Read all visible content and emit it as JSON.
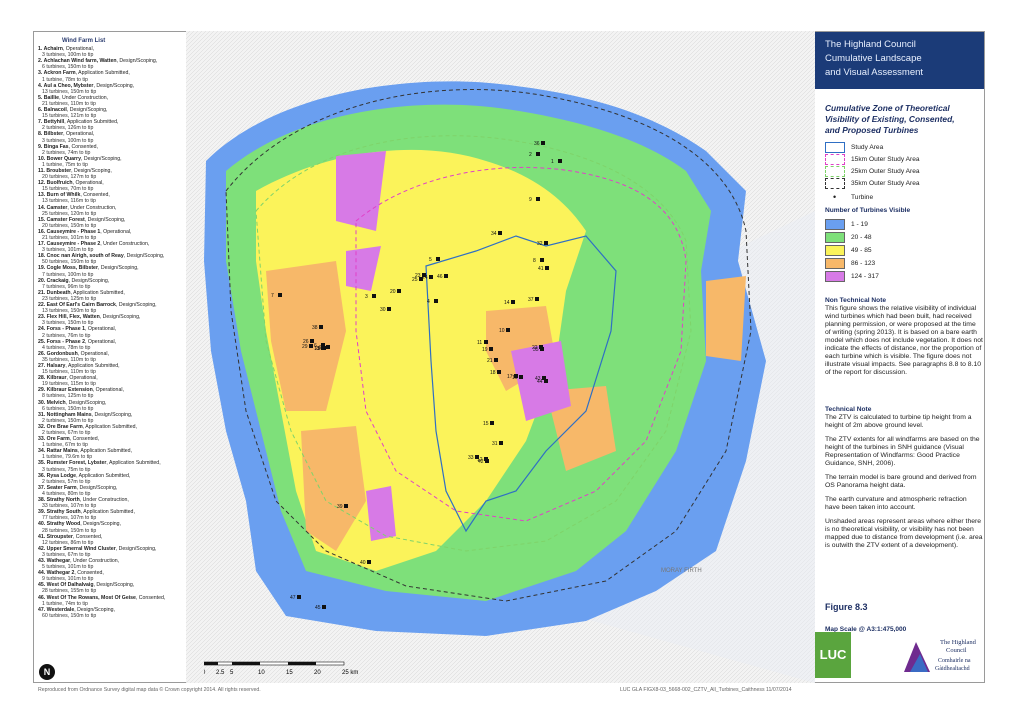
{
  "wind_farm_list": {
    "title": "Wind Farm List",
    "items": [
      {
        "name": "1. Achairn",
        "status": ", Operational,",
        "detail": "3 turbines, 100m to tip"
      },
      {
        "name": "2. Achlachan Wind farm, Watten",
        "status": ", Design/Scoping,",
        "detail": "6 turbines, 150m to tip"
      },
      {
        "name": "3. Ackron Farm",
        "status": ", Application Submitted,",
        "detail": "1 turbine, 78m to tip"
      },
      {
        "name": "4. Aul a Cheo, Mybster",
        "status": ", Design/Scoping,",
        "detail": "13 turbines, 150m to tip"
      },
      {
        "name": "5. Baillie",
        "status": ", Under Construction,",
        "detail": "21 turbines, 110m to tip"
      },
      {
        "name": "6. Balnacoil",
        "status": ", Design/Scoping,",
        "detail": "15 turbines, 121m to tip"
      },
      {
        "name": "7. Bettyhill",
        "status": ", Application Submitted,",
        "detail": "2 turbines, 126m to tip"
      },
      {
        "name": "8. Bilbster",
        "status": ", Operational,",
        "detail": "3 turbines, 100m to tip"
      },
      {
        "name": "9. Binga Fas",
        "status": ", Consented,",
        "detail": "2 turbines, 74m to tip"
      },
      {
        "name": "10. Bower Quarry",
        "status": ", Design/Scoping,",
        "detail": "1 turbine, 75m to tip"
      },
      {
        "name": "11. Broubster",
        "status": ", Design/Scoping,",
        "detail": "20 turbines, 127m to tip"
      },
      {
        "name": "12. Buolfruich",
        "status": ", Operational,",
        "detail": "15 turbines, 70m to tip"
      },
      {
        "name": "13. Burn of Whilk",
        "status": ", Consented,",
        "detail": "13 turbines, 116m to tip"
      },
      {
        "name": "14. Camster",
        "status": ", Under Construction,",
        "detail": "25 turbines, 120m to tip"
      },
      {
        "name": "15. Camster Forest",
        "status": ", Design/Scoping,",
        "detail": "20 turbines, 150m to tip"
      },
      {
        "name": "16. Causeymire - Phase 1",
        "status": ", Operational,",
        "detail": "21 turbines, 101m to tip"
      },
      {
        "name": "17. Causeymire - Phase 2",
        "status": ", Under Construction,",
        "detail": "3 turbines, 101m to tip"
      },
      {
        "name": "18. Cnoc nan Airigh, south of Reay",
        "status": ", Design/Scoping,",
        "detail": "50 turbines, 150m to tip"
      },
      {
        "name": "19. Cogle Moss, Bilbster",
        "status": ", Design/Scoping,",
        "detail": "7 turbines, 100m to tip"
      },
      {
        "name": "20. Crackaig",
        "status": ", Design/Scoping,",
        "detail": "7 turbines, 96m to tip"
      },
      {
        "name": "21. Dunbeath",
        "status": ", Application Submitted,",
        "detail": "23 turbines, 125m to tip"
      },
      {
        "name": "22. East Of Earl's Cairn Barrock",
        "status": ", Design/Scoping,",
        "detail": "13 turbines, 150m to tip"
      },
      {
        "name": "23. Flex Hill, Flex, Watten",
        "status": ", Design/Scoping,",
        "detail": "3 turbines, 150m to tip"
      },
      {
        "name": "24. Forss - Phase 1",
        "status": ", Operational,",
        "detail": "2 turbines, 76m to tip"
      },
      {
        "name": "25. Forss - Phase 2",
        "status": ", Operational,",
        "detail": "4 turbines, 78m to tip"
      },
      {
        "name": "26. Gordonbush",
        "status": ", Operational,",
        "detail": "35 turbines, 110m to tip"
      },
      {
        "name": "27. Halsary",
        "status": ", Application Submitted,",
        "detail": "15 turbines, 110m to tip"
      },
      {
        "name": "28. Kilbraur",
        "status": ", Operational,",
        "detail": "19 turbines, 115m to tip"
      },
      {
        "name": "29. Kilbraur Extension",
        "status": ", Operational,",
        "detail": "8 turbines, 125m to tip"
      },
      {
        "name": "30. Melvich",
        "status": ", Design/Scoping,",
        "detail": "6 turbines, 150m to tip"
      },
      {
        "name": "31. Nottingham Mains",
        "status": ", Design/Scoping,",
        "detail": "2 turbines, 150m to tip"
      },
      {
        "name": "32. Ore Brae Farm",
        "status": ", Application Submitted,",
        "detail": "2 turbines, 67m to tip"
      },
      {
        "name": "33. Ore Farm",
        "status": ", Consented,",
        "detail": "1 turbine, 67m to tip"
      },
      {
        "name": "34. Rattar Mains",
        "status": ", Application Submitted,",
        "detail": "1 turbine, 79.6m to tip"
      },
      {
        "name": "35. Rumster Forest, Lybster",
        "status": ", Application Submitted,",
        "detail": "3 turbines, 75m to tip"
      },
      {
        "name": "36. Rysa Lodge",
        "status": ", Application Submitted,",
        "detail": "2 turbines, 57m to tip"
      },
      {
        "name": "37. Seater Farm",
        "status": ", Design/Scoping,",
        "detail": "4 turbines, 80m to tip"
      },
      {
        "name": "38. Strathy North",
        "status": ", Under Construction,",
        "detail": "33 turbines, 107m to tip"
      },
      {
        "name": "39. Strathy South",
        "status": ", Application Submitted,",
        "detail": "77 turbines, 107m to tip"
      },
      {
        "name": "40. Strathy Wood",
        "status": ", Design/Scoping,",
        "detail": "28 turbines, 150m to tip"
      },
      {
        "name": "41. Stroupster",
        "status": ", Consented,",
        "detail": "12 turbines, 86m to tip"
      },
      {
        "name": "42. Upper Smerral Wind Cluster",
        "status": ", Design/Scoping,",
        "detail": "3 turbines, 67m to tip"
      },
      {
        "name": "43. Wathegar",
        "status": ", Under Construction,",
        "detail": "5 turbines, 101m to tip"
      },
      {
        "name": "44. Wathegar 2",
        "status": ", Consented,",
        "detail": "9 turbines, 101m to tip"
      },
      {
        "name": "45. West Of Dalhalvaig",
        "status": ", Design/Scoping,",
        "detail": "28 turbines, 155m to tip"
      },
      {
        "name": "46. West Of The Rowans, Most Of Geise",
        "status": ", Consented,",
        "detail": "1 turbine, 74m to tip"
      },
      {
        "name": "47. Westerdale",
        "status": ", Design/Scoping,",
        "detail": "60 turbines, 150m to tip"
      }
    ]
  },
  "header": {
    "line1": "The Highland Council",
    "line2": "Cumulative Landscape",
    "line3": "and Visual Assessment"
  },
  "map_title": {
    "line1": "Cumulative Zone of Theoretical",
    "line2": "Visibility of Existing, Consented,",
    "line3": "and Proposed Turbines"
  },
  "legend": {
    "boundaries": [
      {
        "label": "Study Area",
        "color": "#2f6fc4",
        "style": "solid"
      },
      {
        "label": "15km Outer Study Area",
        "color": "#e040c8",
        "style": "dashed"
      },
      {
        "label": "25km Outer Study Area",
        "color": "#7fd36a",
        "style": "dashed"
      },
      {
        "label": "35km Outer Study Area",
        "color": "#333333",
        "style": "dashed"
      }
    ],
    "turbine_label": "Turbine",
    "visibility_title": "Number of Turbines Visible",
    "classes": [
      {
        "label": "1 - 19",
        "color": "#6a9ff0"
      },
      {
        "label": "20 - 48",
        "color": "#7ee07a"
      },
      {
        "label": "49 - 85",
        "color": "#fbf35a"
      },
      {
        "label": "86 - 123",
        "color": "#f7b869"
      },
      {
        "label": "124 - 317",
        "color": "#d77ae6"
      }
    ]
  },
  "notes": {
    "ntn_title": "Non Technical Note",
    "ntn_text": "This figure shows the relative visibility of individual wind turbines which had been built, had received planning permission, or were proposed at the time of writing (spring 2013).  It is based on a bare earth model which does not include vegetation. It does not indicate the effects of distance, nor the proportion of each turbine which is visible. The figure does not illustrate visual impacts.  See paragraphs 8.8 to 8.10 of the report for discussion.",
    "tn_title": "Technical Note",
    "tn_text1": "The ZTV is calculated to turbine tip height from a height of 2m above ground level.",
    "tn_text2": "The ZTV extents for all windfarms are based on the height of the turbines in SNH guidance (Visual Representation of Windfarms: Good Practice Guidance, SNH, 2006).",
    "tn_text3": "The terrain model is bare ground and derived from OS Panorama height data.",
    "tn_text4": "The earth curvature and atmospheric refraction have been taken into account.",
    "tn_text5": "Unshaded areas represent areas where either there is no theoretical visibility, or visibility has not been mapped due to distance from development (i.e. area is outwith the ZTV extent of a development)."
  },
  "figure": "Figure 8.3",
  "map_scale": "Map Scale @ A3:1:475,000",
  "scale_bar": {
    "ticks": [
      "0",
      "2.5",
      "5",
      "10",
      "15",
      "20",
      "25 km"
    ]
  },
  "north_label": "N",
  "map_labels": {
    "sea": "MORAY FIRTH"
  },
  "wind_farm_numbers": [
    "1",
    "2",
    "3",
    "4",
    "5",
    "6",
    "7",
    "8",
    "9",
    "10",
    "11",
    "12",
    "13",
    "14",
    "15",
    "16",
    "17",
    "18",
    "19",
    "20",
    "21",
    "22",
    "23",
    "24",
    "25",
    "26",
    "27",
    "28",
    "29",
    "30",
    "31",
    "32",
    "33",
    "34",
    "35",
    "36",
    "37",
    "38",
    "39",
    "40",
    "41",
    "42",
    "43",
    "44",
    "45",
    "46",
    "47"
  ],
  "logos": {
    "luc": "LUC",
    "council1": "The Highland",
    "council2": "Council",
    "council3": "Comhairle na",
    "council4": "Gàidhealtachd"
  },
  "footer": {
    "copyright": "Reproduced from Ordnance Survey digital map data © Crown copyright 2014. All rights reserved.",
    "reference": "LUC GLA FIGX8-03_5668-002_CZTV_All_Turbines_Caithness 11/07/2014"
  }
}
